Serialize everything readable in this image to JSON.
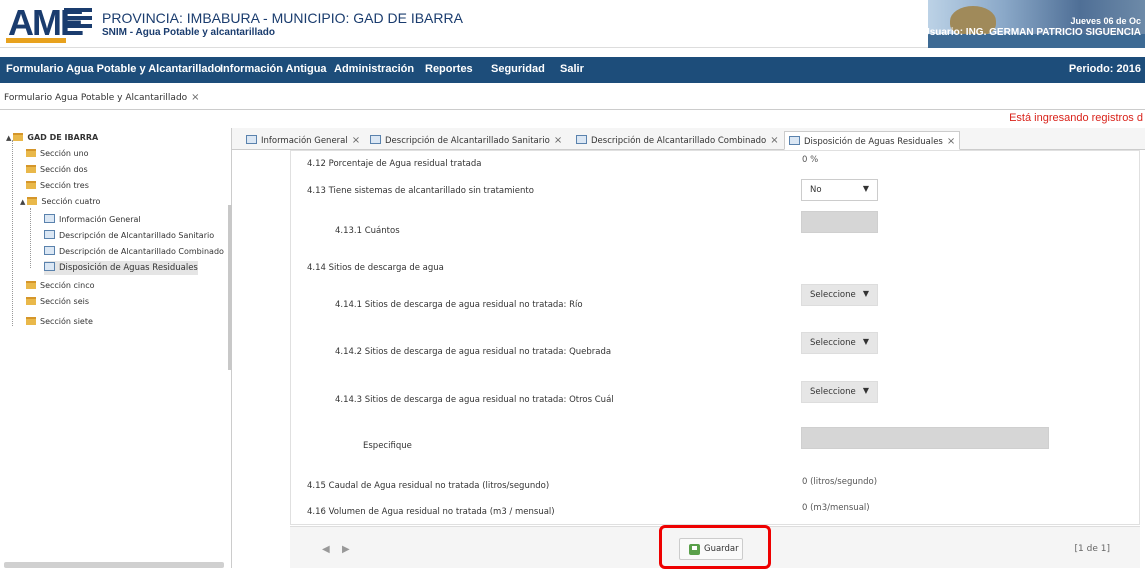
{
  "header": {
    "logo_text": "AME",
    "title": "PROVINCIA: IMBABURA - MUNICIPIO: GAD DE IBARRA",
    "subtitle": "SNIM - Agua Potable y alcantarillado",
    "date_text": "Jueves 06 de Oc",
    "user_text": "Usuario: ING. GERMAN PATRICIO SIGUENCIA"
  },
  "menu": {
    "items": [
      {
        "label": "Formulario Agua Potable y Alcantarillado"
      },
      {
        "label": "Información Antigua"
      },
      {
        "label": "Administración"
      },
      {
        "label": "Reportes"
      },
      {
        "label": "Seguridad"
      },
      {
        "label": "Salir"
      }
    ],
    "periodo": "Periodo: 2016"
  },
  "page_tab": {
    "label": "Formulario Agua Potable y Alcantarillado",
    "close": "×"
  },
  "notice": "Está ingresando registros d",
  "tree": {
    "root": "GAD DE IBARRA",
    "sections": [
      {
        "label": "Sección uno"
      },
      {
        "label": "Sección dos"
      },
      {
        "label": "Sección tres"
      },
      {
        "label": "Sección cuatro"
      },
      {
        "label": "Sección cinco"
      },
      {
        "label": "Sección seis"
      },
      {
        "label": "Sección siete"
      }
    ],
    "children": [
      {
        "label": "Información General"
      },
      {
        "label": "Descripción de Alcantarillado Sanitario"
      },
      {
        "label": "Descripción de Alcantarillado Combinado"
      },
      {
        "label": "Disposición de Aguas Residuales"
      }
    ]
  },
  "form_tabs": [
    {
      "label": "Información General",
      "close": "×"
    },
    {
      "label": "Descripción de Alcantarillado Sanitario",
      "close": "×"
    },
    {
      "label": "Descripción de Alcantarillado Combinado",
      "close": "×"
    },
    {
      "label": "Disposición de Aguas Residuales",
      "close": "×"
    }
  ],
  "form": {
    "q412": {
      "label": "4.12 Porcentaje de Agua residual tratada",
      "value": "0 %"
    },
    "q413": {
      "label": "4.13 Tiene sistemas de alcantarillado sin tratamiento",
      "value": "No"
    },
    "q4131": {
      "label": "4.13.1 Cuántos"
    },
    "q414": {
      "label": "4.14 Sitios de descarga de agua"
    },
    "q4141": {
      "label": "4.14.1 Sitios de descarga de agua residual no tratada: Río",
      "value": "Seleccione"
    },
    "q4142": {
      "label": "4.14.2 Sitios de descarga de agua residual no tratada: Quebrada",
      "value": "Seleccione"
    },
    "q4143": {
      "label": "4.14.3 Sitios de descarga de agua residual no tratada: Otros Cuál",
      "value": "Seleccione"
    },
    "especifique": {
      "label": "Especifique"
    },
    "q415": {
      "label": "4.15 Caudal de Agua residual no tratada (litros/segundo)",
      "value": "0 (litros/segundo)"
    },
    "q416": {
      "label": "4.16 Volumen de Agua residual no tratada (m3 / mensual)",
      "value": "0 (m3/mensual)"
    }
  },
  "footer": {
    "prev": "◀",
    "next": "▶",
    "save_label": "Guardar",
    "page_count": "[1 de 1]"
  },
  "icons": {
    "caret": "▼",
    "tree_toggle": "▲",
    "close": "×"
  },
  "colors": {
    "menubar": "#1d4d7a",
    "notice": "#d9231b",
    "highlight": "#ee0000"
  }
}
